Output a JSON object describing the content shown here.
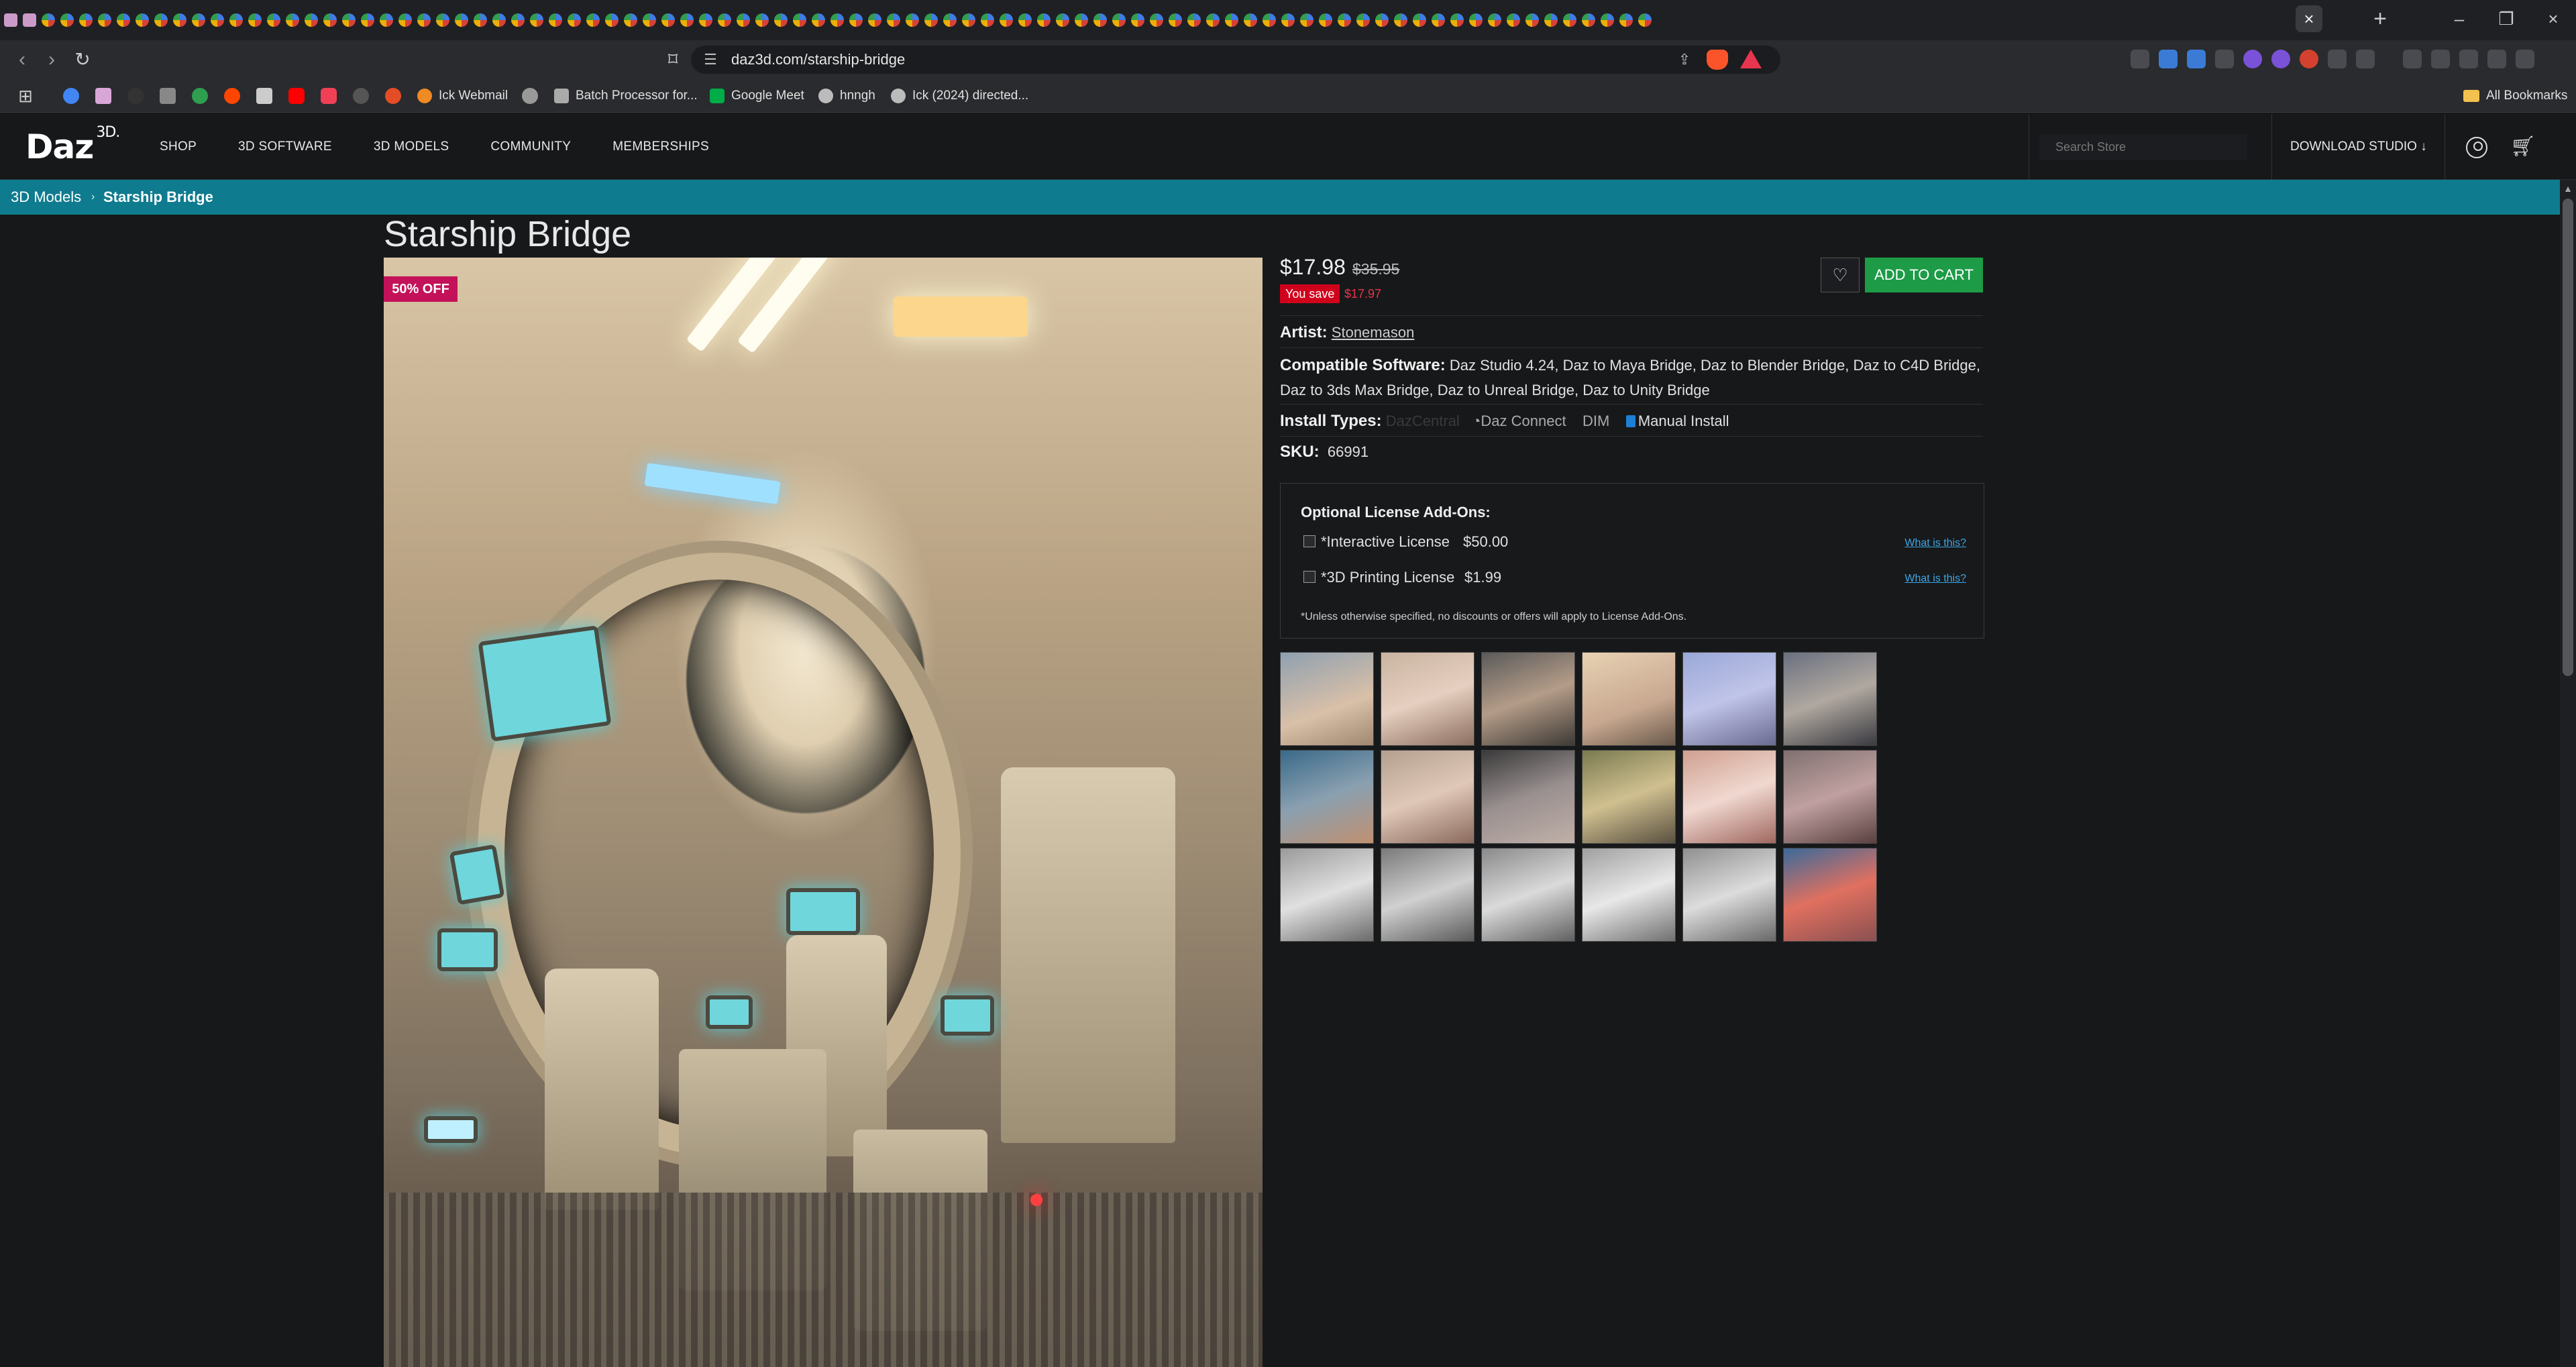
{
  "browser": {
    "url": "daz3d.com/starship-bridge",
    "bookmarks": [
      {
        "label": "Ick Webmail"
      },
      {
        "label": "Batch Processor for..."
      },
      {
        "label": "Google Meet"
      },
      {
        "label": "hnngh"
      },
      {
        "label": "Ick (2024) directed..."
      }
    ],
    "all_bookmarks": "All Bookmarks"
  },
  "header": {
    "logo": "Daz",
    "logo_sup": "3D.",
    "nav": [
      "SHOP",
      "3D SOFTWARE",
      "3D MODELS",
      "COMMUNITY",
      "MEMBERSHIPS"
    ],
    "search_placeholder": "Search Store",
    "download_studio": "DOWNLOAD STUDIO ↓"
  },
  "breadcrumb": {
    "parent": "3D Models",
    "separator": "›",
    "current": "Starship Bridge"
  },
  "product": {
    "title": "Starship Bridge",
    "discount_badge": "50% OFF",
    "price": "$17.98",
    "old_price": "$35.95",
    "you_save_label": "You save",
    "save_amount": "$17.97",
    "add_to_cart": "ADD TO CART",
    "artist_label": "Artist:",
    "artist": "Stonemason",
    "compatible_label": "Compatible Software:",
    "compatible": "Daz Studio 4.24, Daz to Maya Bridge, Daz to Blender Bridge, Daz to C4D Bridge, Daz to 3ds Max Bridge, Daz to Unreal Bridge, Daz to Unity Bridge",
    "install_label": "Install Types:",
    "install_types": [
      "DazCentral",
      "Daz Connect",
      "DIM",
      "Manual Install"
    ],
    "sku_label": "SKU:",
    "sku": "66991"
  },
  "license": {
    "title": "Optional License Add-Ons:",
    "items": [
      {
        "label": "*Interactive License",
        "price": "$50.00",
        "link": "What is this?"
      },
      {
        "label": "*3D Printing License",
        "price": "$1.99",
        "link": "What is this?"
      }
    ],
    "note": "*Unless otherwise specified, no discounts or offers will apply to License Add-Ons."
  },
  "colors": {
    "accent_teal": "#0f7b8e",
    "badge_pink": "#c3125a",
    "save_red": "#d0021b",
    "cart_green": "#1d9b47",
    "link_blue": "#3ba7e6"
  }
}
